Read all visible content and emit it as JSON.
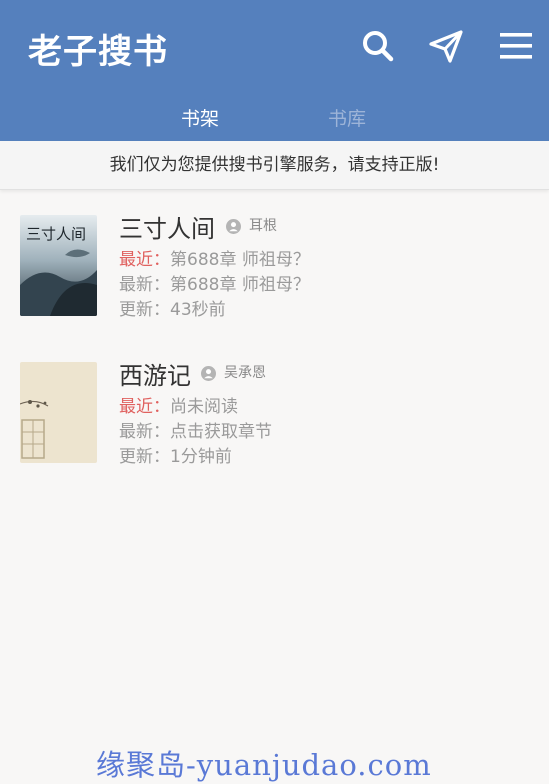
{
  "app": {
    "logo": "老子搜书",
    "icons": [
      "search-icon",
      "send-icon",
      "menu-icon"
    ],
    "accent_color": "#5580bd"
  },
  "tabs": [
    {
      "label": "书架",
      "active": true
    },
    {
      "label": "书库",
      "active": false
    }
  ],
  "notice": "我们仅为您提供搜书引擎服务，请支持正版!",
  "books": [
    {
      "title": "三寸人间",
      "author": "耳根",
      "recent_label": "最近：",
      "recent_value": "第688章 师祖母？",
      "latest": "最新：第688章 师祖母？",
      "updated": "更新：43秒前",
      "cover_text": "三寸人间"
    },
    {
      "title": "西游记",
      "author": "吴承恩",
      "recent_label": "最近：",
      "recent_value": "尚未阅读",
      "latest": "最新：点击获取章节",
      "updated": "更新：1分钟前"
    }
  ],
  "watermark": "缘聚岛-yuanjudao.com"
}
